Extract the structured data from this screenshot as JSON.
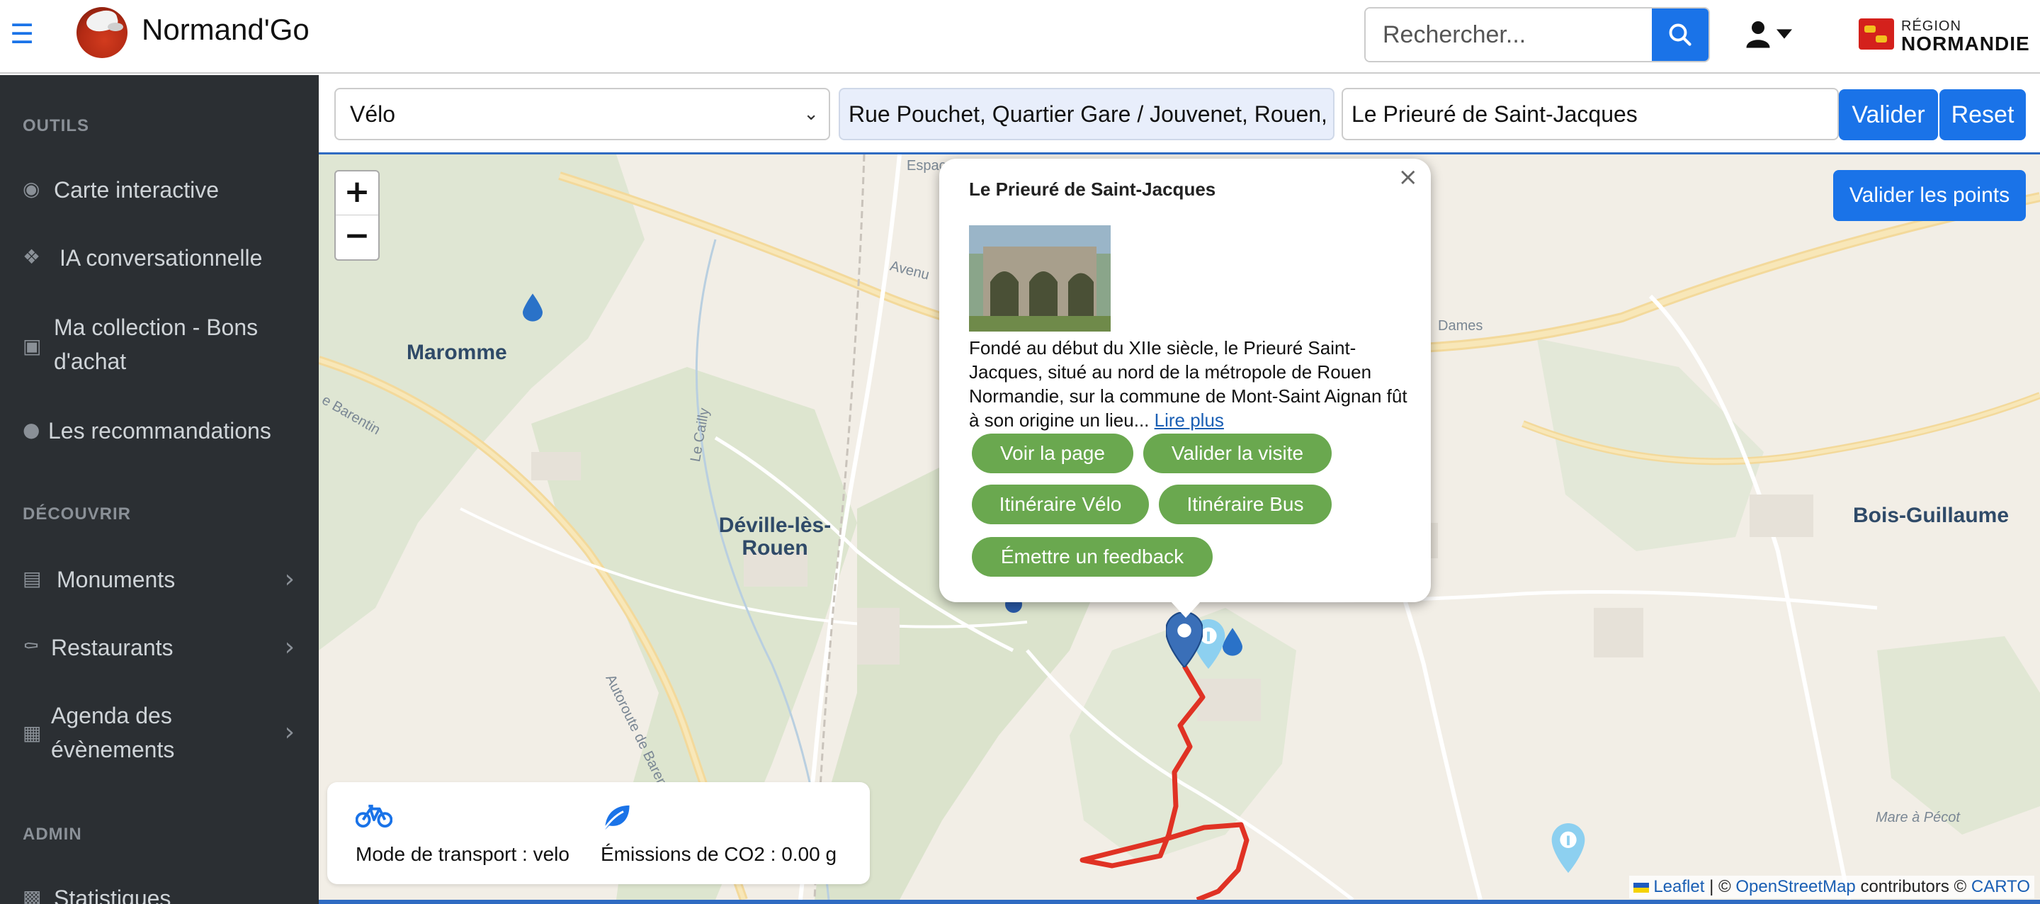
{
  "header": {
    "brand": "Normand'Go",
    "search_placeholder": "Rechercher...",
    "region_line1": "RÉGION",
    "region_line2": "NORMANDIE"
  },
  "sidebar": {
    "sections": [
      {
        "title": "OUTILS"
      },
      {
        "title": "DÉCOUVRIR"
      },
      {
        "title": "ADMIN"
      }
    ],
    "items": [
      {
        "label": "Carte interactive",
        "icon": "globe-icon"
      },
      {
        "label": "IA conversationnelle",
        "icon": "chat-icon"
      },
      {
        "label": "Ma collection - Bons d'achat",
        "icon": "gift-icon"
      },
      {
        "label": "Les recommandations",
        "icon": "lightbulb-icon"
      },
      {
        "label": "Monuments",
        "icon": "book-icon"
      },
      {
        "label": "Restaurants",
        "icon": "utensils-icon"
      },
      {
        "label": "Agenda des évènements",
        "icon": "calendar-icon"
      },
      {
        "label": "Statistiques",
        "icon": "chart-icon"
      }
    ]
  },
  "route_form": {
    "mode": "Vélo",
    "from": "Rue Pouchet, Quartier Gare / Jouvenet, Rouen,",
    "to": "Le Prieuré de Saint-Jacques",
    "valider": "Valider",
    "reset": "Reset"
  },
  "map": {
    "valider_points": "Valider les points",
    "zoom_in": "+",
    "zoom_out": "−",
    "labels": {
      "maromme": "Maromme",
      "deville": "Déville-lès-Rouen",
      "bois_guillaume": "Bois-Guillaume",
      "mare": "Mare à Pécot",
      "avenue": "Avenu",
      "dames": "Dames",
      "barentin": "e Barentin",
      "autoroute": "Autoroute de Barent",
      "cailly": "Le Cailly",
      "espace": "Espac"
    },
    "attribution": {
      "leaflet": "Leaflet",
      "sep": "| ©",
      "osm": "OpenStreetMap",
      "contrib": "contributors ©",
      "carto": "CARTO"
    }
  },
  "popup": {
    "title": "Le Prieuré de Saint-Jacques",
    "description": "Fondé au début du XIIe siècle, le Prieuré Saint-Jacques, situé au nord de la métropole de Rouen Normandie, sur la commune de Mont-Saint Aignan fût à son origine un lieu...",
    "read_more": "Lire plus",
    "buttons": {
      "voir": "Voir la page",
      "valider_visite": "Valider la visite",
      "velo": "Itinéraire Vélo",
      "bus": "Itinéraire Bus",
      "feedback": "Émettre un feedback"
    }
  },
  "stats": {
    "mode": "Mode de transport : velo",
    "co2": "Émissions de CO2 : 0.00 g"
  },
  "colors": {
    "primary": "#1a73e8",
    "sidebar_bg": "#2b2f33",
    "popup_button": "#6aa84f",
    "route": "#e03224"
  }
}
